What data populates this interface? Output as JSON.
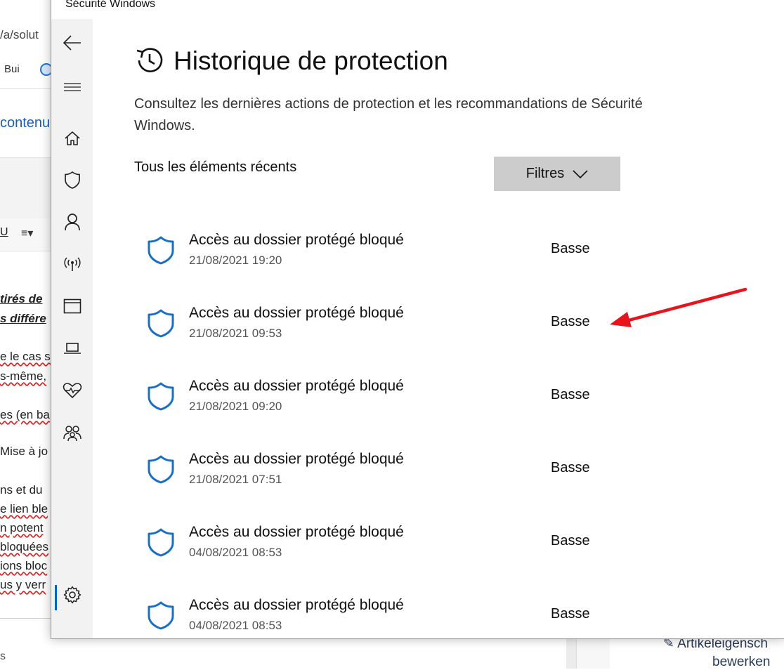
{
  "background_app": {
    "url_fragment": "/a/solut",
    "toolbar_text": "Bui",
    "link_text": "contenu",
    "underline_glyph": "U",
    "lines": [
      {
        "text": "tirés de",
        "style": "bi"
      },
      {
        "text": "s différe",
        "style": "bi"
      },
      {
        "text": "e le cas s",
        "style": "squig"
      },
      {
        "text": "s-même,",
        "style": "squig"
      },
      {
        "text": "es (en ba",
        "style": "squig"
      },
      {
        "text": "Mise à jo",
        "style": "plain"
      },
      {
        "text": "ns et du",
        "style": "plain"
      },
      {
        "text": "e lien ble",
        "style": "squig"
      },
      {
        "text": "n potent",
        "style": "squig"
      },
      {
        "text": "bloquées",
        "style": "squig"
      },
      {
        "text": "ions bloc",
        "style": "squig"
      },
      {
        "text": "us y verr",
        "style": "squig"
      }
    ],
    "bottom_left_text": "s",
    "right_panel_text": "Artikeleigensch",
    "right_panel_text2": "bewerken"
  },
  "window": {
    "title": "Sécurité Windows"
  },
  "nav": {
    "items": [
      {
        "name": "back-icon"
      },
      {
        "name": "hamburger-icon"
      },
      {
        "name": "home-icon"
      },
      {
        "name": "shield-icon"
      },
      {
        "name": "person-icon"
      },
      {
        "name": "network-icon"
      },
      {
        "name": "app-browser-icon"
      },
      {
        "name": "device-icon"
      },
      {
        "name": "health-icon"
      },
      {
        "name": "family-icon"
      },
      {
        "name": "settings-icon"
      }
    ]
  },
  "page": {
    "title": "Historique de protection",
    "description": "Consultez les dernières actions de protection et les recommandations de Sécurité Windows.",
    "recent_label": "Tous les éléments récents",
    "filter_label": "Filtres"
  },
  "history": [
    {
      "title": "Accès au dossier protégé bloqué",
      "date": "21/08/2021 19:20",
      "severity": "Basse"
    },
    {
      "title": "Accès au dossier protégé bloqué",
      "date": "21/08/2021 09:53",
      "severity": "Basse"
    },
    {
      "title": "Accès au dossier protégé bloqué",
      "date": "21/08/2021 09:20",
      "severity": "Basse"
    },
    {
      "title": "Accès au dossier protégé bloqué",
      "date": "21/08/2021 07:51",
      "severity": "Basse"
    },
    {
      "title": "Accès au dossier protégé bloqué",
      "date": "04/08/2021 08:53",
      "severity": "Basse"
    },
    {
      "title": "Accès au dossier protégé bloqué",
      "date": "04/08/2021 08:53",
      "severity": "Basse"
    }
  ],
  "colors": {
    "accent": "#0067c0",
    "shield_blue": "#1a6fc4",
    "annotation_arrow": "#e8141c",
    "filter_bg": "#cccccc",
    "nav_bg": "#f2f2f2"
  }
}
